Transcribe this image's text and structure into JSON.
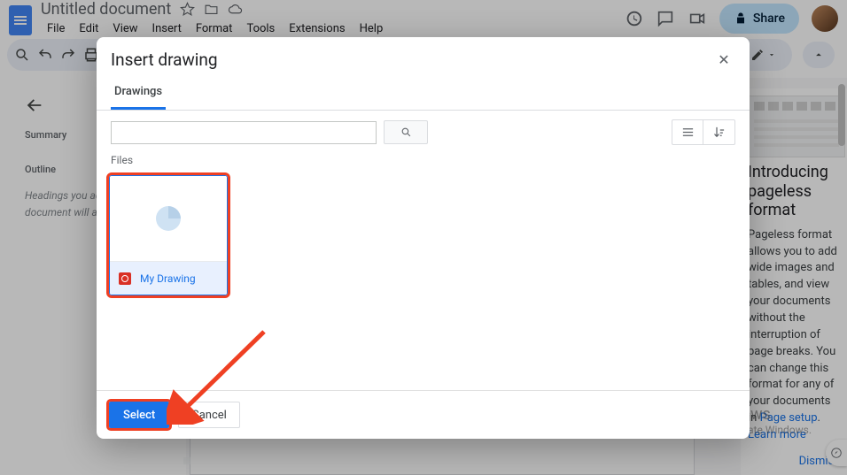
{
  "header": {
    "title": "Untitled document",
    "menus": [
      "File",
      "Edit",
      "View",
      "Insert",
      "Format",
      "Tools",
      "Extensions",
      "Help"
    ],
    "share_label": "Share"
  },
  "outline": {
    "summary_label": "Summary",
    "outline_label": "Outline",
    "hint": "Headings you add to the document will appear here."
  },
  "tip": {
    "title": "Introducing pageless format",
    "body_1": "Pageless format allows you to add wide images and tables, and view",
    "body_2": "your documents without the interruption of page breaks. You can change this",
    "body_3": "format for any of your documents in ",
    "page_setup_link": "Page setup",
    "learn_more": "Learn more",
    "dismiss": "Dismiss"
  },
  "modal": {
    "title": "Insert drawing",
    "tab_label": "Drawings",
    "files_label": "Files",
    "file_name": "My Drawing",
    "select_label": "Select",
    "cancel_label": "Cancel"
  },
  "watermark": {
    "line1": "Activate Windows",
    "line2": "Go to Settings to activate Windows."
  }
}
